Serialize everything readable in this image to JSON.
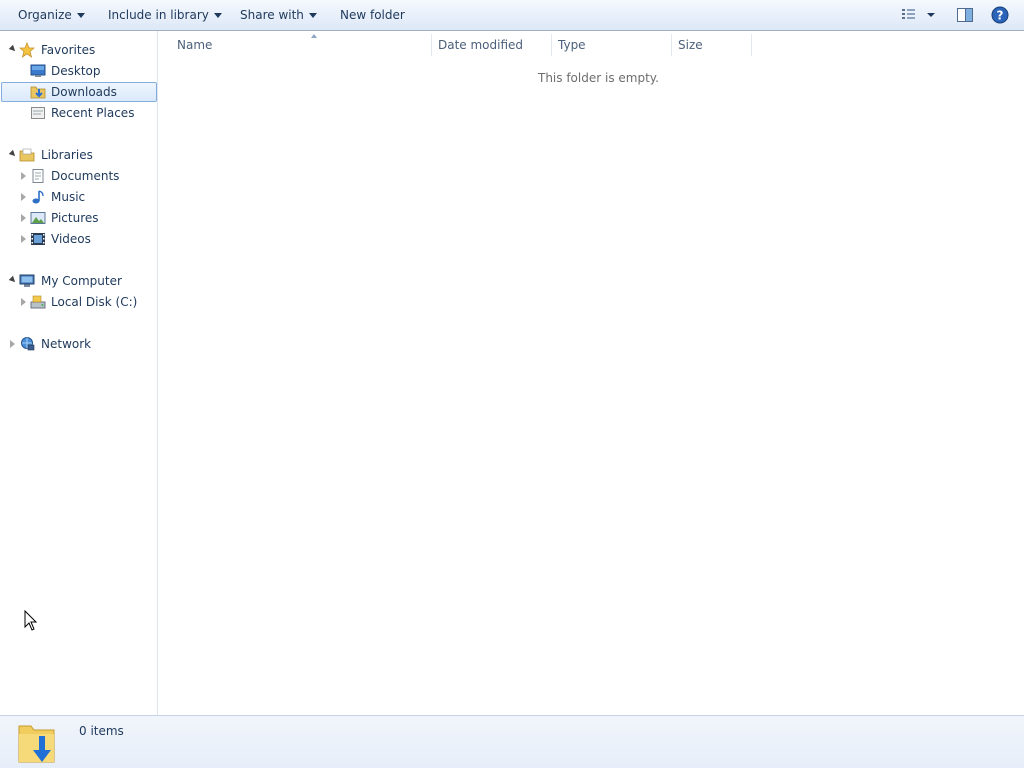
{
  "toolbar": {
    "organize": "Organize",
    "include_in_library": "Include in library",
    "share_with": "Share with",
    "new_folder": "New folder"
  },
  "nav": {
    "favorites": {
      "label": "Favorites",
      "items": [
        "Desktop",
        "Downloads",
        "Recent Places"
      ]
    },
    "libraries": {
      "label": "Libraries",
      "items": [
        "Documents",
        "Music",
        "Pictures",
        "Videos"
      ]
    },
    "computer": {
      "label": "My Computer",
      "items": [
        "Local Disk (C:)"
      ]
    },
    "network": {
      "label": "Network"
    },
    "selected_item": "Downloads"
  },
  "columns": [
    "Name",
    "Date modified",
    "Type",
    "Size"
  ],
  "empty_message": "This folder is empty.",
  "status": {
    "item_count": "0 items"
  },
  "colors": {
    "text": "#1e395b",
    "selection_border": "#84acdd",
    "toolbar_bg": "#eaf1fb"
  }
}
